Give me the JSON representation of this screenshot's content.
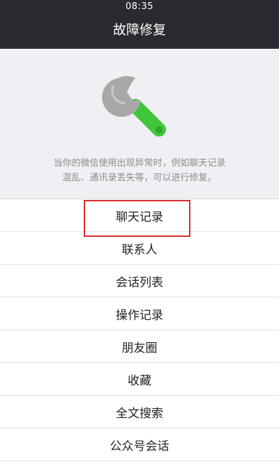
{
  "status_bar": {
    "time": "08:35"
  },
  "header": {
    "title": "故障修复"
  },
  "hero": {
    "icon": "wrench-icon",
    "line1": "当你的微信使用出现异常时，例如聊天记录",
    "line2": "混乱、通讯录丢失等，可以进行修复。"
  },
  "menu": {
    "items": [
      {
        "label": "聊天记录",
        "highlighted": true
      },
      {
        "label": "联系人"
      },
      {
        "label": "会话列表"
      },
      {
        "label": "操作记录"
      },
      {
        "label": "朋友圈"
      },
      {
        "label": "收藏"
      },
      {
        "label": "全文搜索"
      },
      {
        "label": "公众号会话"
      }
    ]
  },
  "colors": {
    "header_bg": "#2b2a30",
    "hero_bg": "#efeff4",
    "highlight_border": "#d72c2c",
    "wrench_handle": "#3fc63a",
    "wrench_head": "#a8a8a8"
  }
}
